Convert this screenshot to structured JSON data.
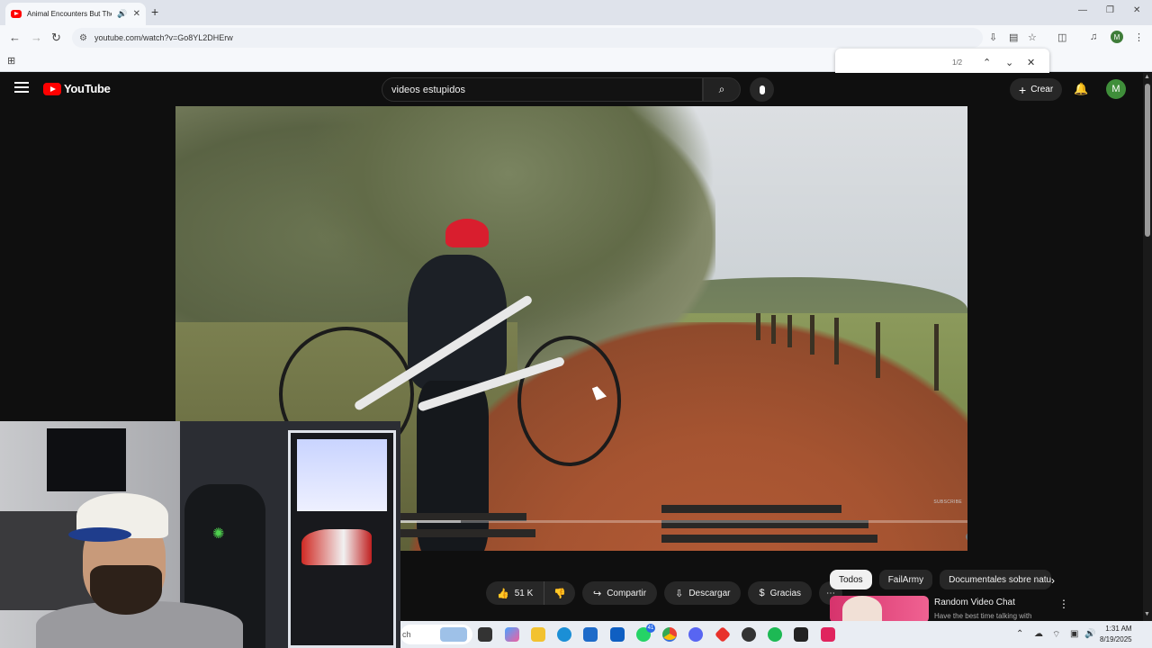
{
  "browser": {
    "tab_title": "Animal Encounters But The",
    "url": "youtube.com/watch?v=Go8YL2DHErw",
    "find_count": "1/2"
  },
  "youtube": {
    "logo_text": "YouTube",
    "search_value": "videos estupidos",
    "create_label": "Crear",
    "avatar_letter": "M"
  },
  "video": {
    "watermark": "SUBSCRIBE",
    "progress_fraction": 0.36
  },
  "actions": {
    "likes": "51 K",
    "share": "Compartir",
    "download": "Descargar",
    "thanks": "Gracias"
  },
  "chips": [
    "Todos",
    "FailArmy",
    "Documentales sobre natural"
  ],
  "recommendation": {
    "title": "Random Video Chat",
    "subtitle": "Have the best time talking with"
  },
  "taskbar": {
    "search_text": "ch",
    "time": "1:31 AM",
    "date": "8/19/2025",
    "whatsapp_badge": "41"
  },
  "colors": {
    "yt_red": "#ff0000",
    "bg": "#0f0f0f",
    "chip_active": "#f1f1f1"
  }
}
